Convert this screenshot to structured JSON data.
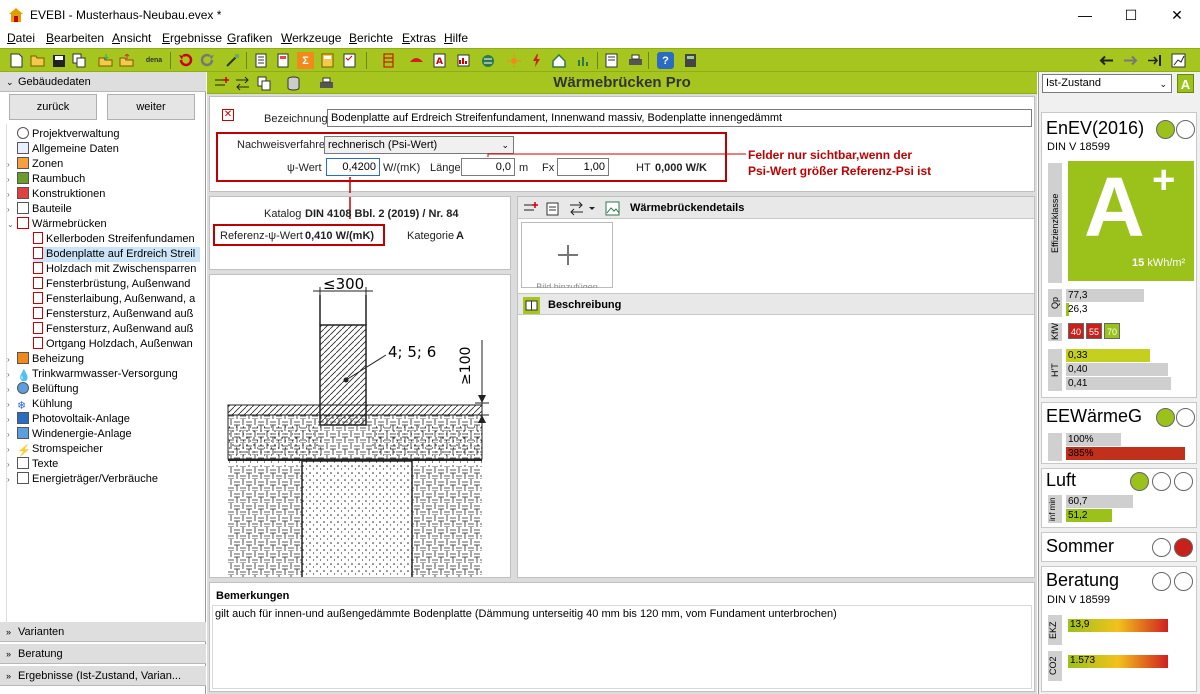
{
  "window": {
    "title": "EVEBI - Musterhaus-Neubau.evex *",
    "minimize_glyph": "—",
    "maximize_glyph": "☐",
    "close_glyph": "✕"
  },
  "menu": [
    "Datei",
    "Bearbeiten",
    "Ansicht",
    "Ergebnisse",
    "Grafiken",
    "Werkzeuge",
    "Berichte",
    "Extras",
    "Hilfe"
  ],
  "toolbar": {
    "dena_label": "dena"
  },
  "left": {
    "header": "Gebäudedaten",
    "back_label": "zurück",
    "next_label": "weiter",
    "tree": [
      {
        "label": "Projektverwaltung"
      },
      {
        "label": "Allgemeine Daten"
      },
      {
        "label": "Zonen"
      },
      {
        "label": "Raumbuch"
      },
      {
        "label": "Konstruktionen"
      },
      {
        "label": "Bauteile"
      },
      {
        "label": "Wärmebrücken"
      },
      {
        "label": "Kellerboden Streifenfundamen"
      },
      {
        "label": "Bodenplatte auf Erdreich Streil"
      },
      {
        "label": "Holzdach mit Zwischensparren"
      },
      {
        "label": "Fensterbrüstung, Außenwand"
      },
      {
        "label": "Fensterlaibung, Außenwand, a"
      },
      {
        "label": "Fenstersturz, Außenwand auß"
      },
      {
        "label": "Fenstersturz, Außenwand auß"
      },
      {
        "label": "Ortgang Holzdach, Außenwan"
      },
      {
        "label": "Beheizung"
      },
      {
        "label": "Trinkwarmwasser-Versorgung"
      },
      {
        "label": "Belüftung"
      },
      {
        "label": "Kühlung"
      },
      {
        "label": "Photovoltaik-Anlage"
      },
      {
        "label": "Windenergie-Anlage"
      },
      {
        "label": "Stromspeicher"
      },
      {
        "label": "Texte"
      },
      {
        "label": "Energieträger/Verbräuche"
      }
    ],
    "footer": [
      "Varianten",
      "Beratung",
      "Ergebnisse (Ist-Zustand, Varian..."
    ]
  },
  "center": {
    "title": "Wärmebrücken Pro",
    "bezeichnung_label": "Bezeichnung",
    "bezeichnung_value": "Bodenplatte auf Erdreich Streifenfundament, Innenwand massiv, Bodenplatte innengedämmt",
    "nachweis_label": "Nachweisverfahren",
    "nachweis_value": "rechnerisch (Psi-Wert)",
    "psi_label": "ψ-Wert",
    "psi_value": "0,4200",
    "psi_unit": "W/(mK)",
    "laenge_label": "Länge",
    "laenge_value": "0,0",
    "laenge_unit": "m",
    "fx_label": "Fx",
    "fx_value": "1,00",
    "ht_label": "HT",
    "ht_value": "0,000 W/K",
    "note_line1": "Felder nur sichtbar,wenn der",
    "note_line2": "Psi-Wert größer Referenz-Psi ist",
    "katalog_label": "Katalog",
    "katalog_value": "DIN 4108 Bbl. 2 (2019) / Nr. 84",
    "ref_psi_label": "Referenz-ψ-Wert",
    "ref_psi_value": "0,410 W/(mK)",
    "kategorie_label": "Kategorie",
    "kategorie_value": "A",
    "details_title": "Wärmebrückendetails",
    "add_tile_text": "Bild hinzufügen",
    "beschreibung_title": "Beschreibung",
    "bemerkungen_title": "Bemerkungen",
    "bemerkungen_text": "gilt auch für innen-und außengedämmte Bodenplatte (Dämmung unterseitig 40 mm bis 120 mm, vom Fundament unterbrochen)",
    "drawing": {
      "dim_top": "≤300",
      "dim_right": "≥100",
      "marker": "4; 5; 6"
    }
  },
  "right": {
    "dropdown_value": "Ist-Zustand",
    "dropdown_badge": "A",
    "enev": {
      "title": "EnEV(2016)",
      "subtitle": "DIN V 18599",
      "class_label": "Effizienzklasse",
      "class_value": "A",
      "class_plus": "+",
      "value": "15",
      "unit": "kWh/m²",
      "qp_label": "Qp",
      "qp_bars": [
        {
          "text": "77,3",
          "fill": 0.61,
          "color": "#cfcfcf"
        },
        {
          "text": "26,3",
          "fill": 0.02,
          "color": "#9bc11b"
        }
      ],
      "kfw_label": "KfW",
      "kfw": [
        {
          "text": "40",
          "color": "#c8201b"
        },
        {
          "text": "55",
          "color": "#c8201b"
        },
        {
          "text": "70",
          "color": "#9bc11b"
        }
      ],
      "ht_label": "H'T",
      "ht_bars": [
        {
          "text": "0,33",
          "fill": 0.66,
          "color": "#c5cf1e"
        },
        {
          "text": "0,40",
          "fill": 0.8,
          "color": "#cfcfcf"
        },
        {
          "text": "0,41",
          "fill": 0.82,
          "color": "#cfcfcf"
        }
      ]
    },
    "eewg": {
      "title": "EEWärmeG",
      "bars": [
        {
          "text": "100%",
          "fill": 0.43,
          "color": "#cfcfcf"
        },
        {
          "text": "385%",
          "fill": 0.93,
          "color": "#c0301b"
        }
      ]
    },
    "luft": {
      "title": "Luft",
      "label": "inf min",
      "bars": [
        {
          "text": "60,7",
          "fill": 0.52,
          "color": "#cfcfcf"
        },
        {
          "text": "51,2",
          "fill": 0.36,
          "color": "#9bc11b"
        }
      ]
    },
    "sommer": {
      "title": "Sommer"
    },
    "beratung": {
      "title": "Beratung",
      "subtitle": "DIN V 18599",
      "ekz_label": "EKZ",
      "ekz_value": "13,9",
      "co2_label": "CO2",
      "co2_value": "1.573"
    }
  }
}
